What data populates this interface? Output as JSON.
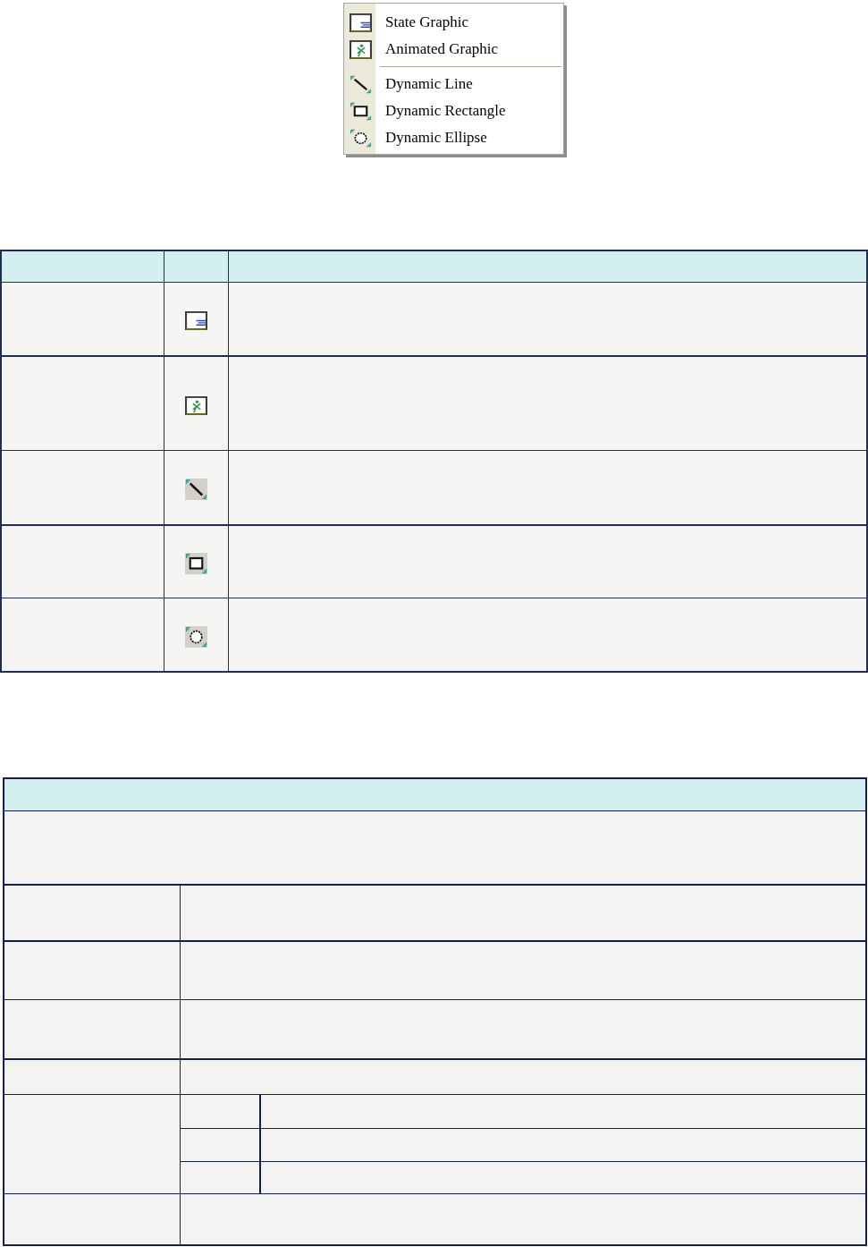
{
  "menu": {
    "groups": [
      {
        "items": [
          {
            "label": "State Graphic",
            "kind": "state-graphic"
          },
          {
            "label": "Animated Graphic",
            "kind": "animated-graphic"
          }
        ]
      },
      {
        "items": [
          {
            "label": "Dynamic Line",
            "kind": "dynamic-line"
          },
          {
            "label": "Dynamic Rectangle",
            "kind": "dynamic-rectangle"
          },
          {
            "label": "Dynamic Ellipse",
            "kind": "dynamic-ellipse"
          }
        ]
      }
    ]
  },
  "icon_table": {
    "rows": [
      {
        "kind": "state-graphic"
      },
      {
        "kind": "animated-graphic"
      },
      {
        "kind": "dynamic-line"
      },
      {
        "kind": "dynamic-rectangle"
      },
      {
        "kind": "dynamic-ellipse"
      }
    ]
  }
}
